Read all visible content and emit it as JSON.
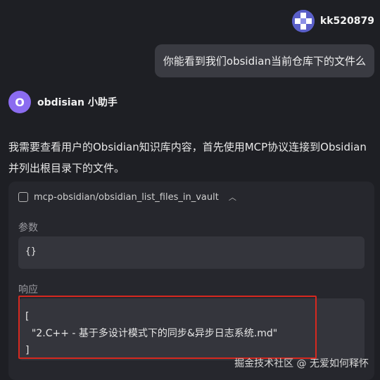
{
  "user": {
    "name": "kk520879",
    "message": "你能看到我们obsidian当前仓库下的文件么"
  },
  "assistant": {
    "avatar_letter": "O",
    "name": "obdisian 小助手",
    "text": "我需要查看用户的Obsidian知识库内容，首先使用MCP协议连接到Obsidian并列出根目录下的文件。"
  },
  "tool_call": {
    "name": "mcp-obsidian/obsidian_list_files_in_vault",
    "params_label": "参数",
    "params_value": "{}",
    "response_label": "响应",
    "response_lines": [
      "[",
      "  \"2.C++ - 基于多设计模式下的同步&异步日志系统.md\"",
      "]"
    ]
  },
  "watermark": "掘金技术社区 @ 无爱如何释怀",
  "colors": {
    "background": "#1e1f24",
    "card": "#26272d",
    "code_box": "#34353c",
    "user_bubble": "#3a3b42",
    "assistant_avatar": "#8b6cf0",
    "highlight": "#d6281f"
  },
  "icons": {
    "tool": "tool-plug-icon",
    "collapse": "chevron-up-icon"
  }
}
